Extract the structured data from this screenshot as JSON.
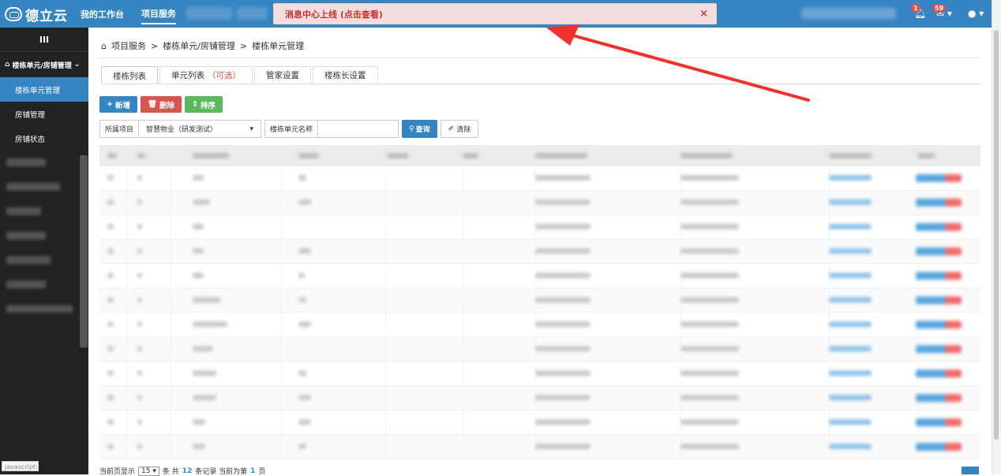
{
  "app": {
    "logo_text": "德立云"
  },
  "topnav": {
    "items": [
      "我的工作台",
      "项目服务"
    ],
    "active": 1
  },
  "notice": {
    "text": "消息中心上线 (点击查看)",
    "close": "×"
  },
  "header_right": {
    "bell_badge": "1",
    "mail_badge": "59"
  },
  "sidebar": {
    "toggle": "III",
    "group": "楼栋单元/房铺管理",
    "items": [
      "楼栋单元管理",
      "房铺管理",
      "房铺状态"
    ],
    "active_index": 0,
    "status_text": "javascript:;"
  },
  "breadcrumb": {
    "items": [
      "项目服务",
      "楼栋单元/房铺管理",
      "楼栋单元管理"
    ],
    "sep": ">"
  },
  "tabs": [
    {
      "label": "楼栋列表",
      "extra": ""
    },
    {
      "label": "单元列表",
      "extra": "（可选）"
    },
    {
      "label": "管家设置",
      "extra": ""
    },
    {
      "label": "楼栋长设置",
      "extra": ""
    }
  ],
  "toolbar": {
    "add": "新增",
    "delete": "删除",
    "sort": "排序"
  },
  "filter": {
    "project_label": "所属项目",
    "project_value": "智慧物业（研发测试）",
    "name_label": "楼栋单元名称",
    "name_value": "",
    "query": "查询",
    "clear": "清除"
  },
  "footer": {
    "prefix": "当前页显示",
    "page_size": "15",
    "mid": "条 共",
    "total": "12",
    "mid2": "条记录 当前为第",
    "page": "1",
    "suffix": "页"
  }
}
